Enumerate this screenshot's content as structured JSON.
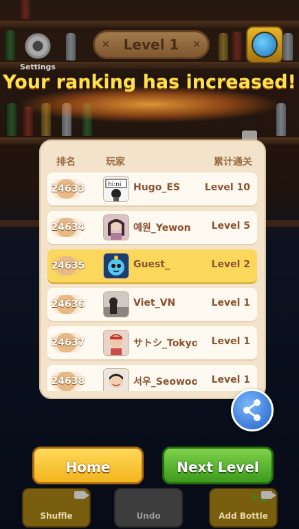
{
  "top": {
    "settings_label": "Settings",
    "level_label": "Level 1"
  },
  "banner": "Your ranking has increased!",
  "ranking": {
    "headers": {
      "rank": "排名",
      "player": "玩家",
      "total": "累计通关"
    },
    "rows": [
      {
        "rank": "24633",
        "name": "Hugo_ES",
        "level": "Level 10",
        "highlight": false
      },
      {
        "rank": "24634",
        "name": "예원_Yewon",
        "level": "Level 5",
        "highlight": false
      },
      {
        "rank": "24635",
        "name": "Guest_",
        "level": "Level 2",
        "highlight": true
      },
      {
        "rank": "24636",
        "name": "Viet_VN",
        "level": "Level 1",
        "highlight": false
      },
      {
        "rank": "24637",
        "name": "サトシ_Tokyo",
        "level": "Level 1",
        "highlight": false
      },
      {
        "rank": "24638",
        "name": "서우_Seowoo",
        "level": "Level 1",
        "highlight": false
      }
    ]
  },
  "buttons": {
    "home": "Home",
    "next": "Next Level"
  },
  "tools": {
    "shuffle": "Shuffle",
    "undo": "Undo",
    "add_bottle": "Add Bottle",
    "add_badge": "+1"
  },
  "colors": {
    "highlight_row": "#fbd85c",
    "home": "#f2b41e",
    "next": "#3d9a1d",
    "banner_text": "#ffe14a"
  }
}
